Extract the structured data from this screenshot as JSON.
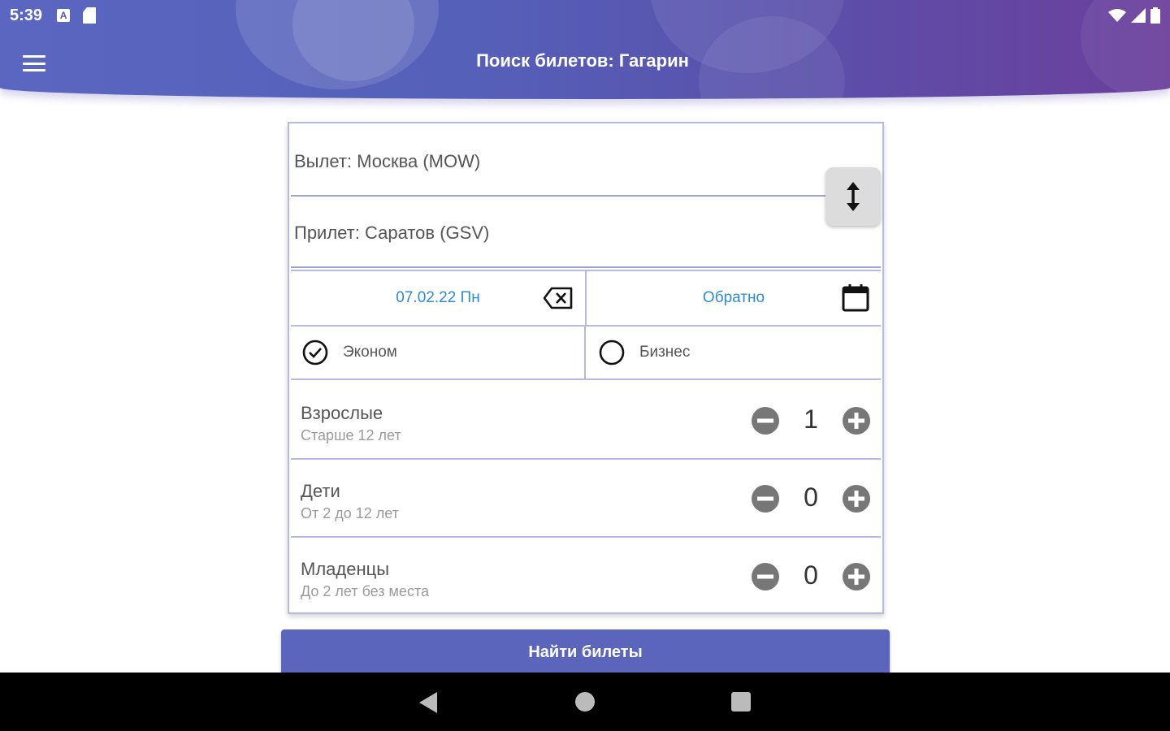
{
  "status_bar": {
    "time": "5:39",
    "notification_letter": "A"
  },
  "header": {
    "title": "Поиск билетов: Гагарин"
  },
  "form": {
    "departure": "Вылет: Москва (MOW)",
    "arrival": "Прилет: Саратов (GSV)",
    "date_there": "07.02.22 Пн",
    "date_return": "Обратно",
    "classes": [
      {
        "label": "Эконом",
        "selected": true
      },
      {
        "label": "Бизнес",
        "selected": false
      }
    ],
    "passengers": [
      {
        "title": "Взрослые",
        "subtitle": "Старше 12 лет",
        "count": "1"
      },
      {
        "title": "Дети",
        "subtitle": "От 2 до 12 лет",
        "count": "0"
      },
      {
        "title": "Младенцы",
        "subtitle": "До 2 лет без места",
        "count": "0"
      }
    ],
    "search_label": "Найти билеты"
  },
  "colors": {
    "primary": "#5b65bc",
    "accent_text": "#2d8bd6",
    "divider": "#b7b9dd"
  },
  "icons": {
    "menu": "menu-icon",
    "swap": "swap-vertical-icon",
    "clear_date": "backspace-icon",
    "calendar": "calendar-icon",
    "checked": "check-circle-icon",
    "unchecked": "radio-empty-icon",
    "minus": "minus-circle-icon",
    "plus": "plus-circle-icon"
  }
}
